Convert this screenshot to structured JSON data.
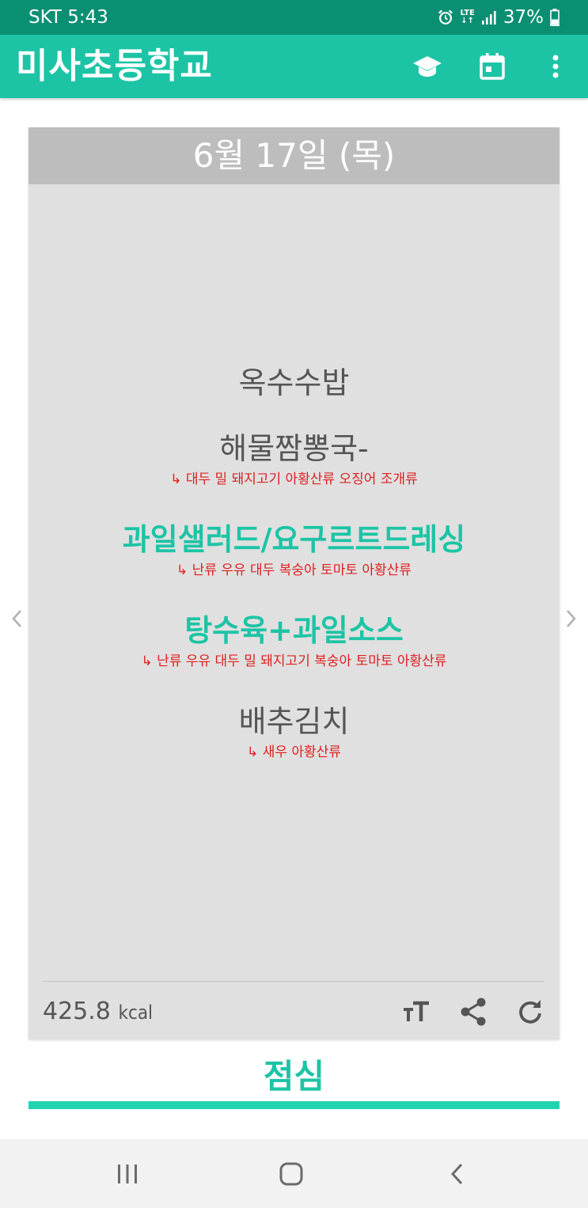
{
  "status_bar": {
    "carrier_time": "SKT 5:43",
    "network": "LTE",
    "battery": "37%",
    "icons": [
      "alarm-icon",
      "lte-icon",
      "signal-icon",
      "battery-icon"
    ]
  },
  "app_bar": {
    "title": "미사초등학교",
    "actions": [
      "school-cap-icon",
      "calendar-icon",
      "more-vert-icon"
    ]
  },
  "card": {
    "date": "6월 17일 (목)",
    "menu": [
      {
        "dish": "옥수수밥",
        "highlight": false,
        "allergy": ""
      },
      {
        "dish": "해물짬뽕국-",
        "highlight": false,
        "allergy": "↳ 대두 밀 돼지고기 아황산류 오징어 조개류"
      },
      {
        "dish": "과일샐러드/요구르트드레싱",
        "highlight": true,
        "allergy": "↳ 난류 우유 대두 복숭아 토마토 아황산류"
      },
      {
        "dish": "탕수육+과일소스",
        "highlight": true,
        "allergy": "↳ 난류 우유 대두 밀 돼지고기 복숭아 토마토 아황산류"
      },
      {
        "dish": "배추김치",
        "highlight": false,
        "allergy": "↳ 새우 아황산류"
      }
    ],
    "kcal_value": "425.8",
    "kcal_unit": "kcal",
    "actions": [
      "text-size-icon",
      "share-icon",
      "refresh-icon"
    ]
  },
  "meal_tab": {
    "label": "점심"
  },
  "colors": {
    "status_bar": "#0a8f73",
    "accent": "#1cc4a5",
    "allergy": "#e02020",
    "card_bg": "#e0e0e0",
    "card_header": "#bdbdbd"
  },
  "nav_bar": {
    "buttons": [
      "recent-apps-icon",
      "home-icon",
      "back-icon"
    ]
  }
}
